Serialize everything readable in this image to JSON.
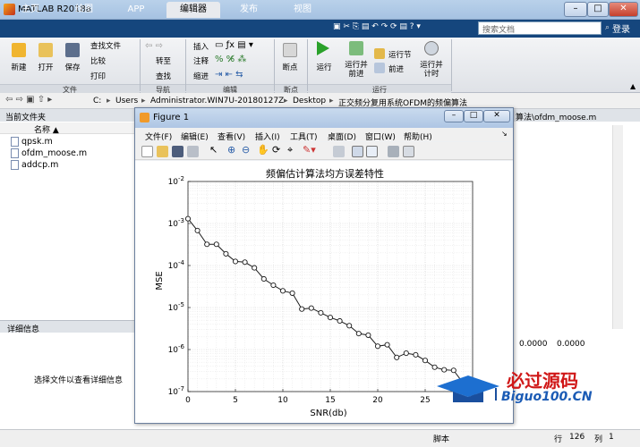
{
  "window": {
    "title": "MATLAB R2018a",
    "min": "–",
    "max": "□",
    "close": "✕"
  },
  "tabs": [
    "主页",
    "绘图",
    "APP",
    "编辑器",
    "发布",
    "视图"
  ],
  "active_tab": "编辑器",
  "search": {
    "placeholder": "搜索文档"
  },
  "login": "登录",
  "ribbon": {
    "file": {
      "new": "新建",
      "open": "打开",
      "save": "保存",
      "find_files": "查找文件",
      "compare": "比较",
      "print": "打印",
      "section": "文件"
    },
    "nav": {
      "goto": "转至",
      "find": "查找",
      "section": "导航"
    },
    "edit": {
      "insert": "插入",
      "comment": "注释",
      "indent": "缩进",
      "section": "编辑"
    },
    "breakpoints": {
      "label": "断点",
      "section": "断点"
    },
    "run": {
      "run": "运行",
      "run_advance": "运行并\n前进",
      "run_section": "运行节",
      "advance": "前进",
      "run_time": "运行并\n计时",
      "section": "运行"
    }
  },
  "path": [
    "C:",
    "Users",
    "Administrator.WIN7U-20180127Z",
    "Desktop",
    "正交频分复用系统OFDM的频偏算法"
  ],
  "current_folder": {
    "title": "当前文件夹",
    "col": "名称 ▲",
    "files": [
      "qpsk.m",
      "ofdm_moose.m",
      "addcp.m"
    ]
  },
  "details": {
    "title": "详细信息",
    "message": "选择文件以查看详细信息"
  },
  "editor_tab": "算法\\ofdm_moose.m",
  "cmd_values": [
    "0.0000",
    "0.0000"
  ],
  "status": {
    "script": "脚本",
    "row_label": "行",
    "row": "126",
    "col_label": "列",
    "col": "1"
  },
  "figure": {
    "title": "Figure 1",
    "menu": [
      "文件(F)",
      "编辑(E)",
      "查看(V)",
      "插入(I)",
      "工具(T)",
      "桌面(D)",
      "窗口(W)",
      "帮助(H)"
    ]
  },
  "watermark": {
    "line1": "必过源码",
    "line2": "Biguo100.CN"
  },
  "chart_data": {
    "type": "line",
    "title": "频偏估计算法均方误差特性",
    "xlabel": "SNR(db)",
    "ylabel": "MSE",
    "xlim": [
      0,
      30
    ],
    "ylim": [
      1e-07,
      0.01
    ],
    "yscale": "log",
    "grid": true,
    "xticks": [
      0,
      5,
      10,
      15,
      20,
      25,
      30
    ],
    "yticks": [
      "10^-7",
      "10^-6",
      "10^-5",
      "10^-4",
      "10^-3",
      "10^-2"
    ],
    "x": [
      0,
      1,
      2,
      3,
      4,
      5,
      6,
      7,
      8,
      9,
      10,
      11,
      12,
      13,
      14,
      15,
      16,
      17,
      18,
      19,
      20,
      21,
      22,
      23,
      24,
      25,
      26,
      27,
      28,
      29,
      30
    ],
    "y": [
      0.0013,
      0.00068,
      0.00032,
      0.00032,
      0.00019,
      0.000125,
      0.00012,
      8.8e-05,
      4.8e-05,
      3.4e-05,
      2.5e-05,
      2.2e-05,
      9.2e-06,
      9.7e-06,
      7.5e-06,
      5.8e-06,
      4.8e-06,
      3.7e-06,
      2.4e-06,
      2.2e-06,
      1.2e-06,
      1.3e-06,
      6.5e-07,
      8.2e-07,
      7.5e-07,
      5.5e-07,
      3.8e-07,
      3.3e-07,
      3.2e-07,
      1.6e-07,
      9e-08
    ]
  }
}
